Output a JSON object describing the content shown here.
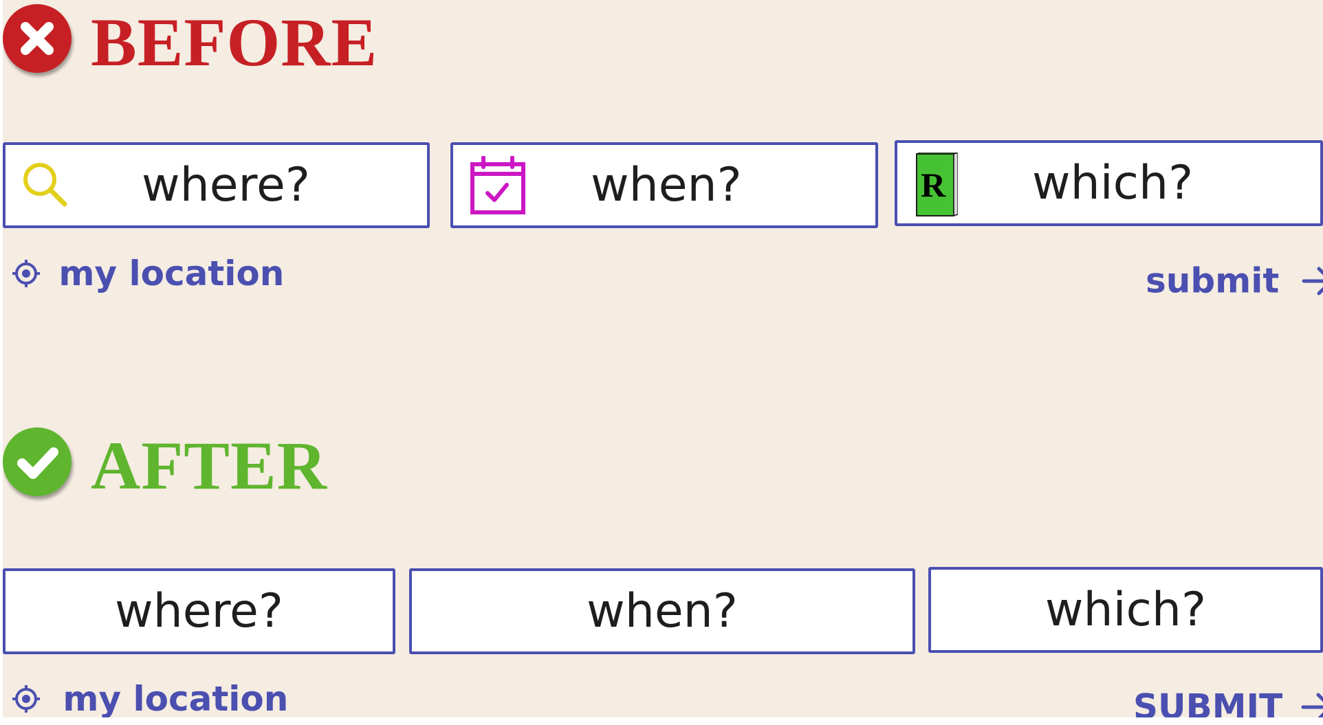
{
  "before": {
    "heading": "BEFORE",
    "badge_icon": "x-circle-icon",
    "heading_color": "#c62024",
    "fields": [
      {
        "label": "where?",
        "icon": "search-icon",
        "icon_color": "#e3cf1c"
      },
      {
        "label": "when?",
        "icon": "calendar-check-icon",
        "icon_color": "#cc18c4"
      },
      {
        "label": "which?",
        "icon": "book-icon",
        "icon_color": "#47c234",
        "icon_letter": "R"
      }
    ],
    "location_link": "my location",
    "location_icon": "crosshair-icon",
    "submit_link": "submit",
    "submit_icon": "arrow-right-icon"
  },
  "after": {
    "heading": "AFTER",
    "badge_icon": "check-circle-icon",
    "heading_color": "#5fb52e",
    "fields": [
      {
        "label": "where?"
      },
      {
        "label": "when?"
      },
      {
        "label": "which?"
      }
    ],
    "location_link": "my location",
    "location_icon": "crosshair-icon",
    "submit_link": "SUBMIT",
    "submit_icon": "arrow-right-icon"
  },
  "colors": {
    "background": "#f5ece2",
    "border": "#4a4fb0",
    "link": "#4a4fb0"
  }
}
